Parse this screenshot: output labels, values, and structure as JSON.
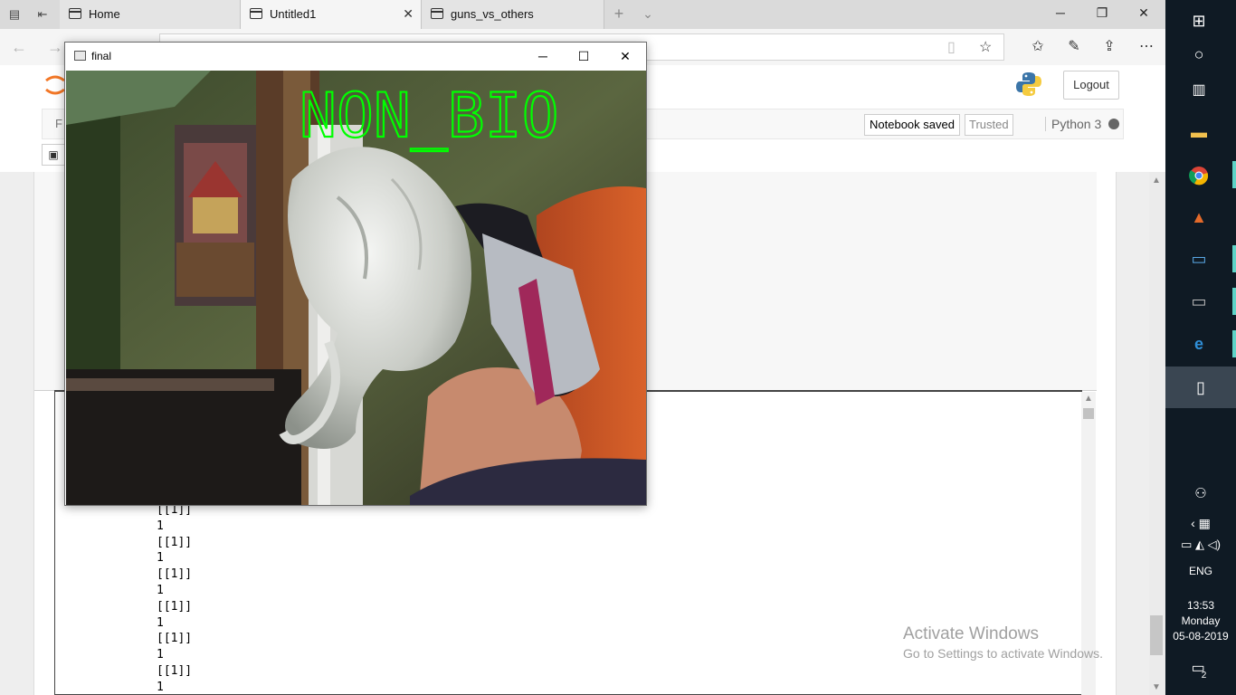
{
  "browser": {
    "tabs": [
      {
        "label": "Home"
      },
      {
        "label": "Untitled1"
      },
      {
        "label": "guns_vs_others"
      }
    ],
    "new_tab_glyph": "+",
    "tab_list_glyph": "⌄",
    "window_controls": {
      "minimize": "─",
      "maximize": "❐",
      "close": "✕"
    },
    "address_url": "",
    "toolbar_icons": [
      "reading-view-icon",
      "favorite-star-icon",
      "favorites-hub-icon",
      "pen-icon",
      "share-icon",
      "more-icon"
    ]
  },
  "jupyter": {
    "menu_first": "F",
    "notebook_status": "Notebook saved",
    "trusted_label": "Trusted",
    "kernel_name": "Python 3",
    "logout_label": "Logout"
  },
  "output": {
    "lines": [
      "[[1]]",
      "1",
      "[[1]]",
      "1",
      "[[1]]",
      "1",
      "[[1]]",
      "1",
      "[[1]]",
      "1",
      "[[1]]",
      "1"
    ]
  },
  "cv_window": {
    "title": "final",
    "overlay_text": "NON_BIO",
    "overlay_color": "#00ff00",
    "controls": {
      "minimize": "─",
      "maximize": "☐",
      "close": "✕"
    }
  },
  "watermark": {
    "title": "Activate Windows",
    "subtitle": "Go to Settings to activate Windows."
  },
  "taskbar": {
    "language": "ENG",
    "time": "13:53",
    "day": "Monday",
    "date": "05-08-2019",
    "notification_count": "2",
    "accent": "#5fd3c7",
    "apps": [
      "windows-start-icon",
      "cortana-icon",
      "task-view-icon",
      "file-explorer-icon",
      "chrome-icon",
      "matlab-icon",
      "remote-desktop-icon",
      "terminal-icon",
      "edge-icon",
      "document-icon"
    ]
  },
  "colors": {
    "taskbar_bg": "#0f1a24",
    "tabbar_bg": "#dadada",
    "active_tab_bg": "#f5f5f5"
  }
}
